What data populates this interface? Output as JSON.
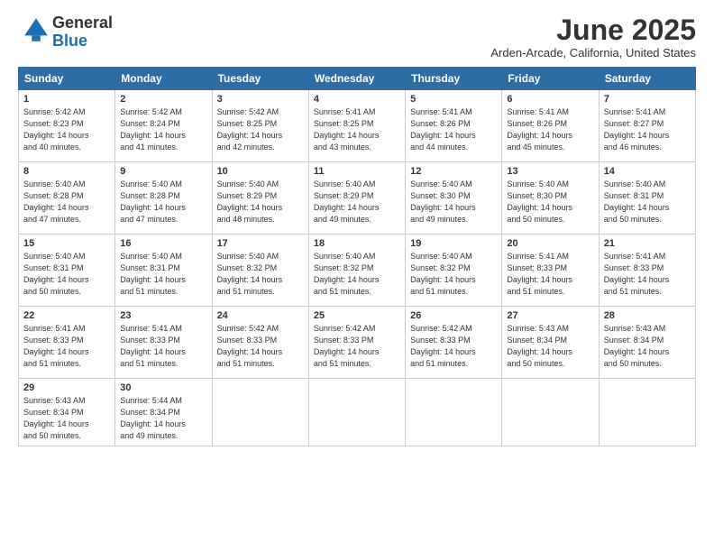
{
  "header": {
    "logo_line1": "General",
    "logo_line2": "Blue",
    "month_title": "June 2025",
    "location": "Arden-Arcade, California, United States"
  },
  "days_of_week": [
    "Sunday",
    "Monday",
    "Tuesday",
    "Wednesday",
    "Thursday",
    "Friday",
    "Saturday"
  ],
  "weeks": [
    [
      {
        "day": "1",
        "info": "Sunrise: 5:42 AM\nSunset: 8:23 PM\nDaylight: 14 hours\nand 40 minutes."
      },
      {
        "day": "2",
        "info": "Sunrise: 5:42 AM\nSunset: 8:24 PM\nDaylight: 14 hours\nand 41 minutes."
      },
      {
        "day": "3",
        "info": "Sunrise: 5:42 AM\nSunset: 8:25 PM\nDaylight: 14 hours\nand 42 minutes."
      },
      {
        "day": "4",
        "info": "Sunrise: 5:41 AM\nSunset: 8:25 PM\nDaylight: 14 hours\nand 43 minutes."
      },
      {
        "day": "5",
        "info": "Sunrise: 5:41 AM\nSunset: 8:26 PM\nDaylight: 14 hours\nand 44 minutes."
      },
      {
        "day": "6",
        "info": "Sunrise: 5:41 AM\nSunset: 8:26 PM\nDaylight: 14 hours\nand 45 minutes."
      },
      {
        "day": "7",
        "info": "Sunrise: 5:41 AM\nSunset: 8:27 PM\nDaylight: 14 hours\nand 46 minutes."
      }
    ],
    [
      {
        "day": "8",
        "info": "Sunrise: 5:40 AM\nSunset: 8:28 PM\nDaylight: 14 hours\nand 47 minutes."
      },
      {
        "day": "9",
        "info": "Sunrise: 5:40 AM\nSunset: 8:28 PM\nDaylight: 14 hours\nand 47 minutes."
      },
      {
        "day": "10",
        "info": "Sunrise: 5:40 AM\nSunset: 8:29 PM\nDaylight: 14 hours\nand 48 minutes."
      },
      {
        "day": "11",
        "info": "Sunrise: 5:40 AM\nSunset: 8:29 PM\nDaylight: 14 hours\nand 49 minutes."
      },
      {
        "day": "12",
        "info": "Sunrise: 5:40 AM\nSunset: 8:30 PM\nDaylight: 14 hours\nand 49 minutes."
      },
      {
        "day": "13",
        "info": "Sunrise: 5:40 AM\nSunset: 8:30 PM\nDaylight: 14 hours\nand 50 minutes."
      },
      {
        "day": "14",
        "info": "Sunrise: 5:40 AM\nSunset: 8:31 PM\nDaylight: 14 hours\nand 50 minutes."
      }
    ],
    [
      {
        "day": "15",
        "info": "Sunrise: 5:40 AM\nSunset: 8:31 PM\nDaylight: 14 hours\nand 50 minutes."
      },
      {
        "day": "16",
        "info": "Sunrise: 5:40 AM\nSunset: 8:31 PM\nDaylight: 14 hours\nand 51 minutes."
      },
      {
        "day": "17",
        "info": "Sunrise: 5:40 AM\nSunset: 8:32 PM\nDaylight: 14 hours\nand 51 minutes."
      },
      {
        "day": "18",
        "info": "Sunrise: 5:40 AM\nSunset: 8:32 PM\nDaylight: 14 hours\nand 51 minutes."
      },
      {
        "day": "19",
        "info": "Sunrise: 5:40 AM\nSunset: 8:32 PM\nDaylight: 14 hours\nand 51 minutes."
      },
      {
        "day": "20",
        "info": "Sunrise: 5:41 AM\nSunset: 8:33 PM\nDaylight: 14 hours\nand 51 minutes."
      },
      {
        "day": "21",
        "info": "Sunrise: 5:41 AM\nSunset: 8:33 PM\nDaylight: 14 hours\nand 51 minutes."
      }
    ],
    [
      {
        "day": "22",
        "info": "Sunrise: 5:41 AM\nSunset: 8:33 PM\nDaylight: 14 hours\nand 51 minutes."
      },
      {
        "day": "23",
        "info": "Sunrise: 5:41 AM\nSunset: 8:33 PM\nDaylight: 14 hours\nand 51 minutes."
      },
      {
        "day": "24",
        "info": "Sunrise: 5:42 AM\nSunset: 8:33 PM\nDaylight: 14 hours\nand 51 minutes."
      },
      {
        "day": "25",
        "info": "Sunrise: 5:42 AM\nSunset: 8:33 PM\nDaylight: 14 hours\nand 51 minutes."
      },
      {
        "day": "26",
        "info": "Sunrise: 5:42 AM\nSunset: 8:33 PM\nDaylight: 14 hours\nand 51 minutes."
      },
      {
        "day": "27",
        "info": "Sunrise: 5:43 AM\nSunset: 8:34 PM\nDaylight: 14 hours\nand 50 minutes."
      },
      {
        "day": "28",
        "info": "Sunrise: 5:43 AM\nSunset: 8:34 PM\nDaylight: 14 hours\nand 50 minutes."
      }
    ],
    [
      {
        "day": "29",
        "info": "Sunrise: 5:43 AM\nSunset: 8:34 PM\nDaylight: 14 hours\nand 50 minutes."
      },
      {
        "day": "30",
        "info": "Sunrise: 5:44 AM\nSunset: 8:34 PM\nDaylight: 14 hours\nand 49 minutes."
      },
      {
        "day": "",
        "info": ""
      },
      {
        "day": "",
        "info": ""
      },
      {
        "day": "",
        "info": ""
      },
      {
        "day": "",
        "info": ""
      },
      {
        "day": "",
        "info": ""
      }
    ]
  ]
}
